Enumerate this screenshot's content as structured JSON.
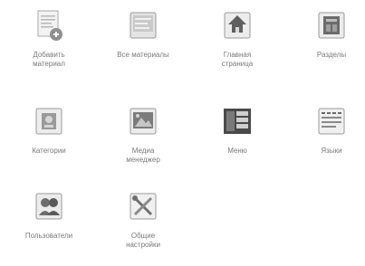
{
  "items": [
    {
      "label": "Добавить\nматериал",
      "icon": "add-article-icon"
    },
    {
      "label": "Все материалы",
      "icon": "articles-icon"
    },
    {
      "label": "Главная\nстраница",
      "icon": "frontpage-icon"
    },
    {
      "label": "Разделы",
      "icon": "sections-icon"
    },
    {
      "label": "Категории",
      "icon": "categories-icon"
    },
    {
      "label": "Медиа\nменеджер",
      "icon": "media-icon"
    },
    {
      "label": "Меню",
      "icon": "menu-icon"
    },
    {
      "label": "Языки",
      "icon": "language-icon"
    },
    {
      "label": "Пользователи",
      "icon": "users-icon"
    },
    {
      "label": "Общие\nнастройки",
      "icon": "config-icon"
    }
  ]
}
